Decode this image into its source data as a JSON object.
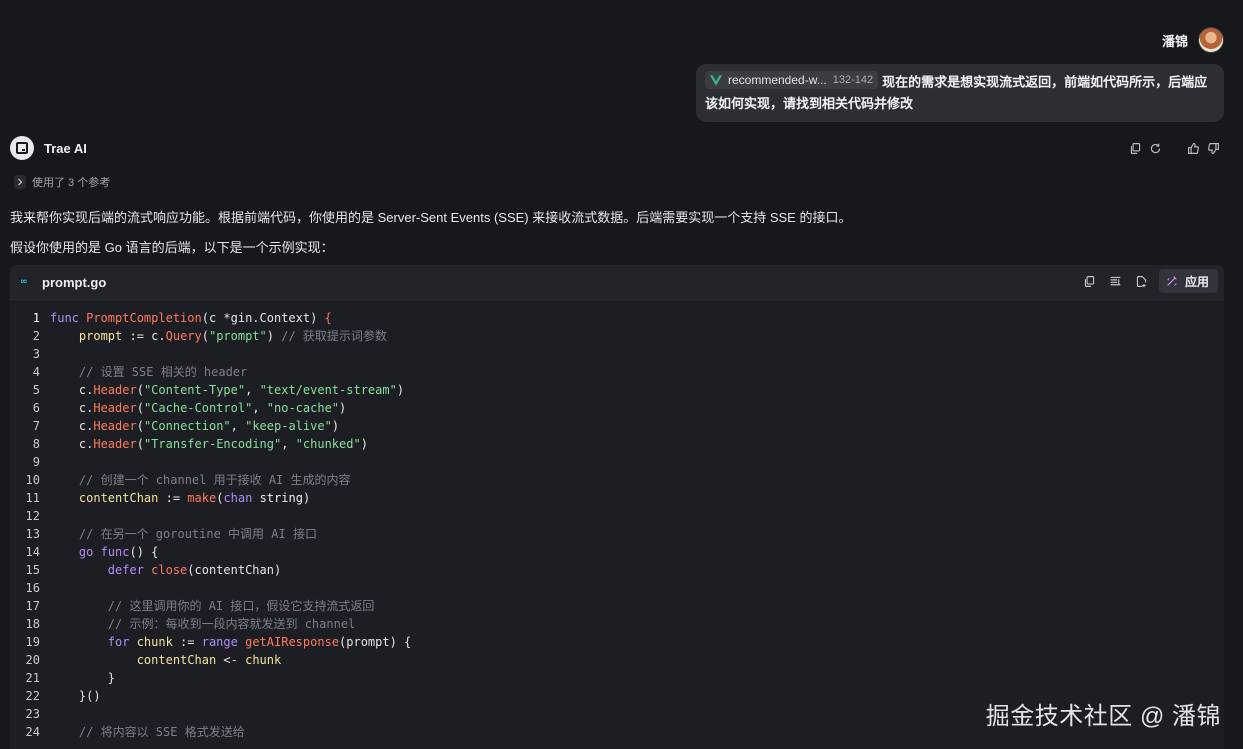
{
  "user": {
    "name": "潘锦"
  },
  "user_message": {
    "chip_label": "recommended-w...",
    "chip_range": "132-142",
    "text": "现在的需求是想实现流式返回，前端如代码所示，后端应该如何实现，请找到相关代码并修改"
  },
  "assistant": {
    "name": "Trae AI",
    "references": "使用了 3 个参考",
    "paragraph1": "我来帮你实现后端的流式响应功能。根据前端代码，你使用的是 Server-Sent Events (SSE) 来接收流式数据。后端需要实现一个支持 SSE 的接口。",
    "paragraph2": "假设你使用的是 Go 语言的后端，以下是一个示例实现："
  },
  "code_block": {
    "language_icon": "go-icon",
    "file_name": "prompt.go",
    "apply_label": "应用",
    "lines": [
      {
        "n": "1",
        "tokens": [
          [
            "kw",
            "func "
          ],
          [
            "fn",
            "PromptCompletion"
          ],
          [
            "pl",
            "(c *gin.Context) "
          ],
          [
            "brace",
            "{"
          ]
        ]
      },
      {
        "n": "2",
        "tokens": [
          [
            "pl",
            "    "
          ],
          [
            "var",
            "prompt"
          ],
          [
            "pl",
            " := c."
          ],
          [
            "fn",
            "Query"
          ],
          [
            "pl",
            "("
          ],
          [
            "str",
            "\"prompt\""
          ],
          [
            "pl",
            ") "
          ],
          [
            "cm",
            "// 获取提示词参数"
          ]
        ]
      },
      {
        "n": "3",
        "tokens": []
      },
      {
        "n": "4",
        "tokens": [
          [
            "pl",
            "    "
          ],
          [
            "cm",
            "// 设置 SSE 相关的 header"
          ]
        ]
      },
      {
        "n": "5",
        "tokens": [
          [
            "pl",
            "    c."
          ],
          [
            "fn",
            "Header"
          ],
          [
            "pl",
            "("
          ],
          [
            "str",
            "\"Content-Type\""
          ],
          [
            "pl",
            ", "
          ],
          [
            "str",
            "\"text/event-stream\""
          ],
          [
            "pl",
            ")"
          ]
        ]
      },
      {
        "n": "6",
        "tokens": [
          [
            "pl",
            "    c."
          ],
          [
            "fn",
            "Header"
          ],
          [
            "pl",
            "("
          ],
          [
            "str",
            "\"Cache-Control\""
          ],
          [
            "pl",
            ", "
          ],
          [
            "str",
            "\"no-cache\""
          ],
          [
            "pl",
            ")"
          ]
        ]
      },
      {
        "n": "7",
        "tokens": [
          [
            "pl",
            "    c."
          ],
          [
            "fn",
            "Header"
          ],
          [
            "pl",
            "("
          ],
          [
            "str",
            "\"Connection\""
          ],
          [
            "pl",
            ", "
          ],
          [
            "str",
            "\"keep-alive\""
          ],
          [
            "pl",
            ")"
          ]
        ]
      },
      {
        "n": "8",
        "tokens": [
          [
            "pl",
            "    c."
          ],
          [
            "fn",
            "Header"
          ],
          [
            "pl",
            "("
          ],
          [
            "str",
            "\"Transfer-Encoding\""
          ],
          [
            "pl",
            ", "
          ],
          [
            "str",
            "\"chunked\""
          ],
          [
            "pl",
            ")"
          ]
        ]
      },
      {
        "n": "9",
        "tokens": []
      },
      {
        "n": "10",
        "tokens": [
          [
            "pl",
            "    "
          ],
          [
            "cm",
            "// 创建一个 channel 用于接收 AI 生成的内容"
          ]
        ]
      },
      {
        "n": "11",
        "tokens": [
          [
            "pl",
            "    "
          ],
          [
            "var",
            "contentChan"
          ],
          [
            "pl",
            " := "
          ],
          [
            "fn",
            "make"
          ],
          [
            "pl",
            "("
          ],
          [
            "kw",
            "chan"
          ],
          [
            "pl",
            " "
          ],
          [
            "ty",
            "string"
          ],
          [
            "pl",
            ")"
          ]
        ]
      },
      {
        "n": "12",
        "tokens": []
      },
      {
        "n": "13",
        "tokens": [
          [
            "pl",
            "    "
          ],
          [
            "cm",
            "// 在另一个 goroutine 中调用 AI 接口"
          ]
        ]
      },
      {
        "n": "14",
        "tokens": [
          [
            "pl",
            "    "
          ],
          [
            "kw",
            "go func"
          ],
          [
            "pl",
            "() {"
          ]
        ]
      },
      {
        "n": "15",
        "tokens": [
          [
            "pl",
            "        "
          ],
          [
            "kw",
            "defer "
          ],
          [
            "fn",
            "close"
          ],
          [
            "pl",
            "(contentChan)"
          ]
        ]
      },
      {
        "n": "16",
        "tokens": []
      },
      {
        "n": "17",
        "tokens": [
          [
            "pl",
            "        "
          ],
          [
            "cm",
            "// 这里调用你的 AI 接口，假设它支持流式返回"
          ]
        ]
      },
      {
        "n": "18",
        "tokens": [
          [
            "pl",
            "        "
          ],
          [
            "cm",
            "// 示例：每收到一段内容就发送到 channel"
          ]
        ]
      },
      {
        "n": "19",
        "tokens": [
          [
            "pl",
            "        "
          ],
          [
            "kw",
            "for "
          ],
          [
            "var",
            "chunk"
          ],
          [
            "pl",
            " := "
          ],
          [
            "kw",
            "range "
          ],
          [
            "fn",
            "getAIResponse"
          ],
          [
            "pl",
            "(prompt) {"
          ]
        ]
      },
      {
        "n": "20",
        "tokens": [
          [
            "pl",
            "            "
          ],
          [
            "var",
            "contentChan"
          ],
          [
            "pl",
            " <- "
          ],
          [
            "var",
            "chunk"
          ]
        ]
      },
      {
        "n": "21",
        "tokens": [
          [
            "pl",
            "        }"
          ]
        ]
      },
      {
        "n": "22",
        "tokens": [
          [
            "pl",
            "    }()"
          ]
        ]
      },
      {
        "n": "23",
        "tokens": []
      },
      {
        "n": "24",
        "tokens": [
          [
            "pl",
            "    "
          ],
          [
            "cm",
            "// 将内容以 SSE 格式发送给"
          ]
        ]
      }
    ]
  },
  "watermark": "掘金技术社区 @ 潘锦",
  "colors": {
    "background": "#17181c",
    "code_background": "#1d1e23",
    "keyword": "#b38cf7",
    "function": "#ff7a5c",
    "string": "#86e09a",
    "comment": "#7c7f88"
  }
}
